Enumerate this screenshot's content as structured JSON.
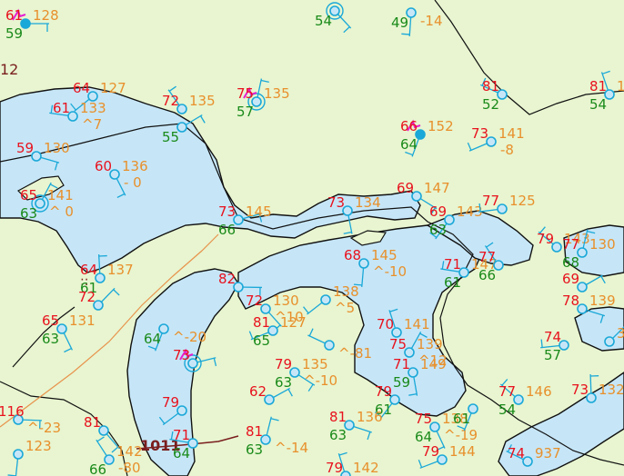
{
  "colors": {
    "land": "#e8f5d0",
    "water": "#c6e6f7",
    "coast": "#111111",
    "border": "#111111",
    "front": "#e8934c",
    "temp": "#e8121e",
    "dew": "#1a8a1a",
    "pres": "#e8902c",
    "wind": "#1aa8d8",
    "thunder": "#e61ed0",
    "low_line": "#7a1e1e",
    "label": "#7a1e1e"
  },
  "labels": {
    "region_12": "12",
    "isobar_1011": "1011",
    "missing_marks": "::"
  },
  "stations": [
    {
      "t": "61",
      "td": "59",
      "p": "128",
      "chg": "",
      "sky": "filled",
      "wx": "thunder"
    },
    {
      "t": "",
      "td": "54",
      "p": "",
      "chg": "",
      "sky": "ring",
      "wx": ""
    },
    {
      "t": "",
      "td": "49",
      "p": "",
      "chg": "-14",
      "sky": "clear",
      "wx": ""
    },
    {
      "t": "64",
      "td": "",
      "p": "127",
      "chg": "",
      "sky": "clear",
      "wx": ""
    },
    {
      "t": "61",
      "td": "",
      "p": "133",
      "chg": "^7",
      "sky": "clear",
      "wx": ""
    },
    {
      "t": "72",
      "td": "",
      "p": "135",
      "chg": "",
      "sky": "clear",
      "wx": ""
    },
    {
      "t": "75",
      "td": "57",
      "p": "135",
      "chg": "",
      "sky": "ring",
      "wx": "thunder"
    },
    {
      "t": "",
      "td": "55",
      "p": "",
      "chg": "",
      "sky": "clear",
      "wx": ""
    },
    {
      "t": "59",
      "td": "",
      "p": "130",
      "chg": "",
      "sky": "clear",
      "wx": ""
    },
    {
      "t": "60",
      "td": "",
      "p": "136",
      "chg": "- 0",
      "sky": "clear",
      "wx": ""
    },
    {
      "t": "66",
      "td": "64",
      "p": "152",
      "chg": "",
      "sky": "filled",
      "wx": "thunder"
    },
    {
      "t": "73",
      "td": "",
      "p": "141",
      "chg": "-8",
      "sky": "clear",
      "wx": ""
    },
    {
      "t": "81",
      "td": "52",
      "p": "",
      "chg": "",
      "sky": "clear",
      "wx": ""
    },
    {
      "t": "81",
      "td": "54",
      "p": "13",
      "chg": "",
      "sky": "clear",
      "wx": ""
    },
    {
      "t": "65",
      "td": "63",
      "p": "141",
      "chg": "^ 0",
      "sky": "ring",
      "wx": ""
    },
    {
      "t": "73",
      "td": "66",
      "p": "145",
      "chg": "",
      "sky": "clear",
      "wx": ""
    },
    {
      "t": "69",
      "td": "",
      "p": "147",
      "chg": "",
      "sky": "clear",
      "wx": ""
    },
    {
      "t": "73",
      "td": "",
      "p": "134",
      "chg": "",
      "sky": "clear",
      "wx": ""
    },
    {
      "t": "69",
      "td": "63",
      "p": "143",
      "chg": "",
      "sky": "clear",
      "wx": ""
    },
    {
      "t": "77",
      "td": "",
      "p": "125",
      "chg": "",
      "sky": "clear",
      "wx": ""
    },
    {
      "t": "79",
      "td": "",
      "p": "143",
      "chg": "",
      "sky": "clear",
      "wx": ""
    },
    {
      "t": "64",
      "td": "61",
      "p": "137",
      "chg": "",
      "sky": "clear",
      "wx": ""
    },
    {
      "t": "72",
      "td": "",
      "p": "",
      "chg": "",
      "sky": "clear",
      "wx": ""
    },
    {
      "t": "82",
      "td": "",
      "p": "",
      "chg": "",
      "sky": "clear",
      "wx": ""
    },
    {
      "t": "72",
      "td": "",
      "p": "130",
      "chg": "^10",
      "sky": "clear",
      "wx": ""
    },
    {
      "t": "68",
      "td": "",
      "p": "145",
      "chg": "^-10",
      "sky": "clear",
      "wx": ""
    },
    {
      "t": "",
      "td": "",
      "p": "138",
      "chg": "^5",
      "sky": "clear",
      "wx": ""
    },
    {
      "t": "71",
      "td": "61",
      "p": "147",
      "chg": "",
      "sky": "clear",
      "wx": ""
    },
    {
      "t": "77",
      "td": "66",
      "p": "",
      "chg": "",
      "sky": "clear",
      "wx": ""
    },
    {
      "t": "77",
      "td": "68",
      "p": "130",
      "chg": "",
      "sky": "clear",
      "wx": ""
    },
    {
      "t": "69",
      "td": "",
      "p": "",
      "chg": "",
      "sky": "clear",
      "wx": ""
    },
    {
      "t": "78",
      "td": "",
      "p": "139",
      "chg": "",
      "sky": "clear",
      "wx": ""
    },
    {
      "t": "65",
      "td": "63",
      "p": "131",
      "chg": "",
      "sky": "clear",
      "wx": ""
    },
    {
      "t": "",
      "td": "64",
      "p": "",
      "chg": "^-20",
      "sky": "clear",
      "wx": ""
    },
    {
      "t": "81",
      "td": "65",
      "p": "127",
      "chg": "",
      "sky": "clear",
      "wx": ""
    },
    {
      "t": "",
      "td": "",
      "p": "",
      "chg": "^-81",
      "sky": "clear",
      "wx": ""
    },
    {
      "t": "70",
      "td": "",
      "p": "141",
      "chg": "",
      "sky": "clear",
      "wx": ""
    },
    {
      "t": "75",
      "td": "",
      "p": "139",
      "chg": "^12",
      "sky": "clear",
      "wx": ""
    },
    {
      "t": "73",
      "td": "",
      "p": "",
      "chg": "",
      "sky": "ring",
      "wx": "thunder"
    },
    {
      "t": "79",
      "td": "63",
      "p": "135",
      "chg": "^-10",
      "sky": "clear",
      "wx": ""
    },
    {
      "t": "71",
      "td": "59",
      "p": "149",
      "chg": "",
      "sky": "clear",
      "wx": ""
    },
    {
      "t": "79",
      "td": "61",
      "p": "",
      "chg": "",
      "sky": "clear",
      "wx": ""
    },
    {
      "t": "74",
      "td": "57",
      "p": "",
      "chg": "",
      "sky": "clear",
      "wx": ""
    },
    {
      "t": "77",
      "td": "54",
      "p": "146",
      "chg": "",
      "sky": "clear",
      "wx": ""
    },
    {
      "t": "73",
      "td": "",
      "p": "132",
      "chg": "",
      "sky": "clear",
      "wx": ""
    },
    {
      "t": "",
      "td": "",
      "p": "34",
      "chg": "",
      "sky": "clear",
      "wx": ""
    },
    {
      "t": "116",
      "td": "",
      "p": "",
      "chg": "^-23",
      "sky": "clear",
      "wx": ""
    },
    {
      "t": "81",
      "td": "",
      "p": "",
      "chg": "",
      "sky": "clear",
      "wx": ""
    },
    {
      "t": "",
      "td": "",
      "p": "123",
      "chg": "",
      "sky": "clear",
      "wx": ""
    },
    {
      "t": "79",
      "td": "",
      "p": "",
      "chg": "",
      "sky": "clear",
      "wx": ""
    },
    {
      "t": "71",
      "td": "64",
      "p": "",
      "chg": "",
      "sky": "clear",
      "wx": ""
    },
    {
      "t": "",
      "td": "66",
      "p": "142",
      "chg": "-80",
      "sky": "clear",
      "wx": ""
    },
    {
      "t": "81",
      "td": "63",
      "p": "",
      "chg": "^-14",
      "sky": "clear",
      "wx": ""
    },
    {
      "t": "62",
      "td": "",
      "p": "",
      "chg": "",
      "sky": "clear",
      "wx": ""
    },
    {
      "t": "81",
      "td": "63",
      "p": "136",
      "chg": "",
      "sky": "clear",
      "wx": ""
    },
    {
      "t": "75",
      "td": "64",
      "p": "138",
      "chg": "^-19",
      "sky": "clear",
      "wx": ""
    },
    {
      "t": "",
      "td": "61",
      "p": "",
      "chg": "",
      "sky": "clear",
      "wx": ""
    },
    {
      "t": "79",
      "td": "",
      "p": "144",
      "chg": "",
      "sky": "clear",
      "wx": ""
    },
    {
      "t": "74",
      "td": "",
      "p": "937",
      "chg": "",
      "sky": "clear",
      "wx": ""
    },
    {
      "t": "79",
      "td": "",
      "p": "142",
      "chg": "",
      "sky": "clear",
      "wx": ""
    }
  ]
}
